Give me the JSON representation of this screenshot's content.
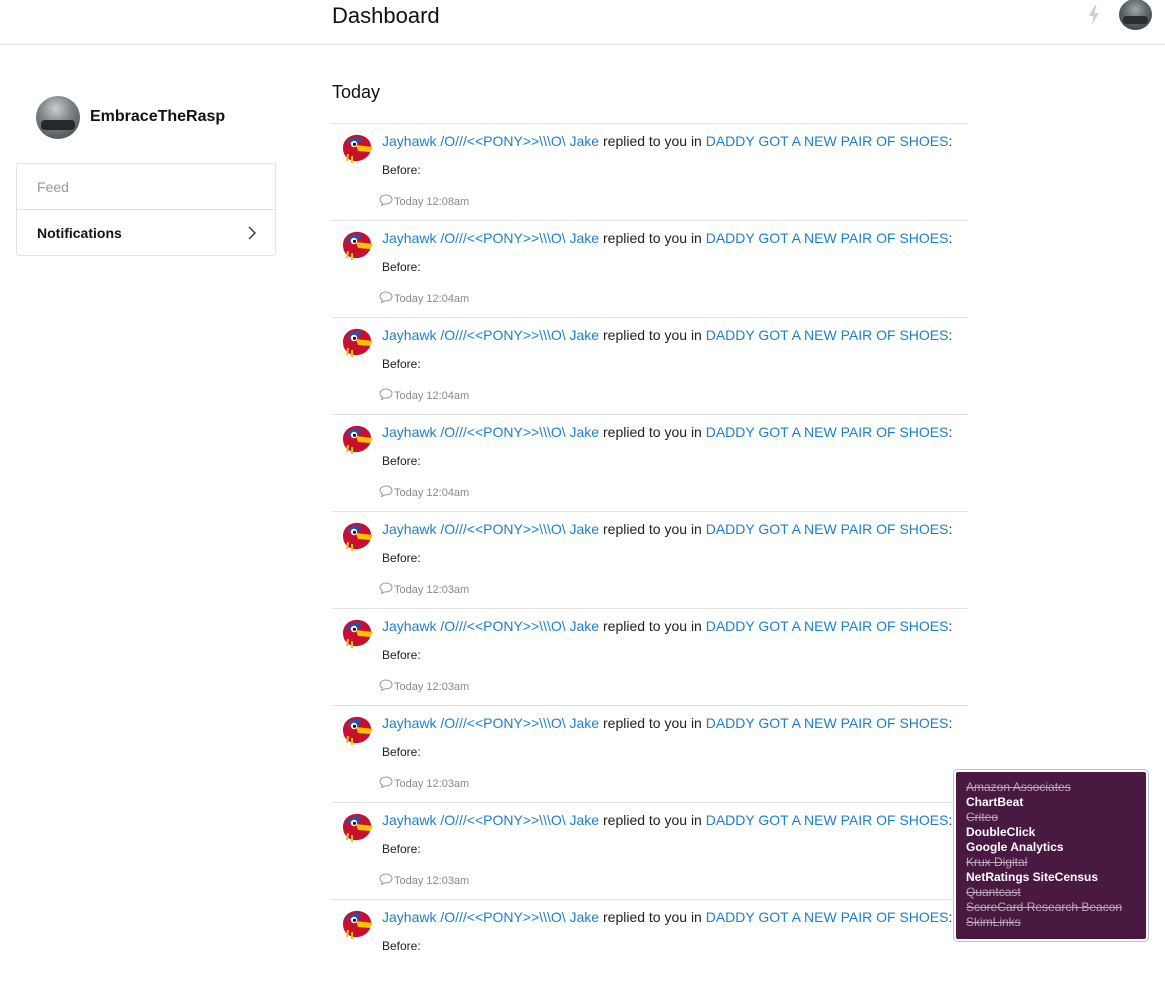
{
  "header": {
    "title": "Dashboard"
  },
  "profile": {
    "name": "EmbraceTheRasp"
  },
  "nav": {
    "feed": "Feed",
    "notifications": "Notifications"
  },
  "section": {
    "title": "Today"
  },
  "notifications": [
    {
      "user": "Jayhawk /O///<<PONY>>\\\\\\O\\ Jake",
      "action": "replied to you in",
      "thread": "DADDY GOT A NEW PAIR OF SHOES",
      "colon": ":",
      "body": "Before:",
      "time": "Today 12:08am"
    },
    {
      "user": "Jayhawk /O///<<PONY>>\\\\\\O\\ Jake",
      "action": "replied to you in",
      "thread": "DADDY GOT A NEW PAIR OF SHOES",
      "colon": ":",
      "body": "Before:",
      "time": "Today 12:04am"
    },
    {
      "user": "Jayhawk /O///<<PONY>>\\\\\\O\\ Jake",
      "action": "replied to you in",
      "thread": "DADDY GOT A NEW PAIR OF SHOES",
      "colon": ":",
      "body": "Before:",
      "time": "Today 12:04am"
    },
    {
      "user": "Jayhawk /O///<<PONY>>\\\\\\O\\ Jake",
      "action": "replied to you in",
      "thread": "DADDY GOT A NEW PAIR OF SHOES",
      "colon": ":",
      "body": "Before:",
      "time": "Today 12:04am"
    },
    {
      "user": "Jayhawk /O///<<PONY>>\\\\\\O\\ Jake",
      "action": "replied to you in",
      "thread": "DADDY GOT A NEW PAIR OF SHOES",
      "colon": ":",
      "body": "Before:",
      "time": "Today 12:03am"
    },
    {
      "user": "Jayhawk /O///<<PONY>>\\\\\\O\\ Jake",
      "action": "replied to you in",
      "thread": "DADDY GOT A NEW PAIR OF SHOES",
      "colon": ":",
      "body": "Before:",
      "time": "Today 12:03am"
    },
    {
      "user": "Jayhawk /O///<<PONY>>\\\\\\O\\ Jake",
      "action": "replied to you in",
      "thread": "DADDY GOT A NEW PAIR OF SHOES",
      "colon": ":",
      "body": "Before:",
      "time": "Today 12:03am"
    },
    {
      "user": "Jayhawk /O///<<PONY>>\\\\\\O\\ Jake",
      "action": "replied to you in",
      "thread": "DADDY GOT A NEW PAIR OF SHOES",
      "colon": ":",
      "body": "Before:",
      "time": "Today 12:03am"
    },
    {
      "user": "Jayhawk /O///<<PONY>>\\\\\\O\\ Jake",
      "action": "replied to you in",
      "thread": "DADDY GOT A NEW PAIR OF SHOES",
      "colon": ":",
      "body": "Before:",
      "time": ""
    }
  ],
  "trackers": [
    {
      "name": "Amazon Associates",
      "blocked": true
    },
    {
      "name": "ChartBeat",
      "blocked": false
    },
    {
      "name": "Criteo",
      "blocked": true
    },
    {
      "name": "DoubleClick",
      "blocked": false
    },
    {
      "name": "Google Analytics",
      "blocked": false
    },
    {
      "name": "Krux Digital",
      "blocked": true
    },
    {
      "name": "NetRatings SiteCensus",
      "blocked": false
    },
    {
      "name": "Quantcast",
      "blocked": true
    },
    {
      "name": "ScoreCard Research Beacon",
      "blocked": true
    },
    {
      "name": "SkimLinks",
      "blocked": true
    }
  ],
  "colors": {
    "link": "#1a7fd1",
    "tracker_panel_bg": "#4a1942",
    "divider": "#e3e3e3"
  },
  "icons": {
    "bolt": "lightning-bolt-icon",
    "chevron": "chevron-right-icon",
    "comment": "comment-bubble-icon",
    "notif_avatar": "jayhawk-mascot-avatar"
  }
}
